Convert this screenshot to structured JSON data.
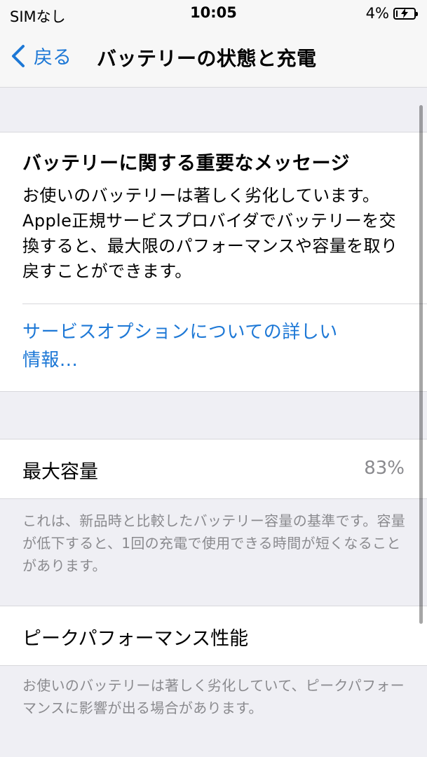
{
  "status_bar": {
    "carrier": "SIMなし",
    "time": "10:05",
    "battery_percent": "4%"
  },
  "nav": {
    "back_label": "戻る",
    "title": "バッテリーの状態と充電"
  },
  "message": {
    "title": "バッテリーに関する重要なメッセージ",
    "body": "お使いのバッテリーは著しく劣化しています。Apple正規サービスプロバイダでバッテリーを交換すると、最大限のパフォーマンスや容量を取り戻すことができます。",
    "link": "サービスオプションについての詳しい情報..."
  },
  "capacity": {
    "label": "最大容量",
    "value": "83%",
    "footnote": "これは、新品時と比較したバッテリー容量の基準です。容量が低下すると、1回の充電で使用できる時間が短くなることがあります。"
  },
  "peak": {
    "label": "ピークパフォーマンス性能",
    "footnote": "お使いのバッテリーは著しく劣化していて、ピークパフォーマンスに影響が出る場合があります。"
  },
  "colors": {
    "accent": "#1d78d6",
    "background": "#efeff4",
    "secondary_text": "#8a8a8e"
  },
  "icons": {
    "back": "chevron-left-icon",
    "battery": "battery-charging-icon"
  }
}
